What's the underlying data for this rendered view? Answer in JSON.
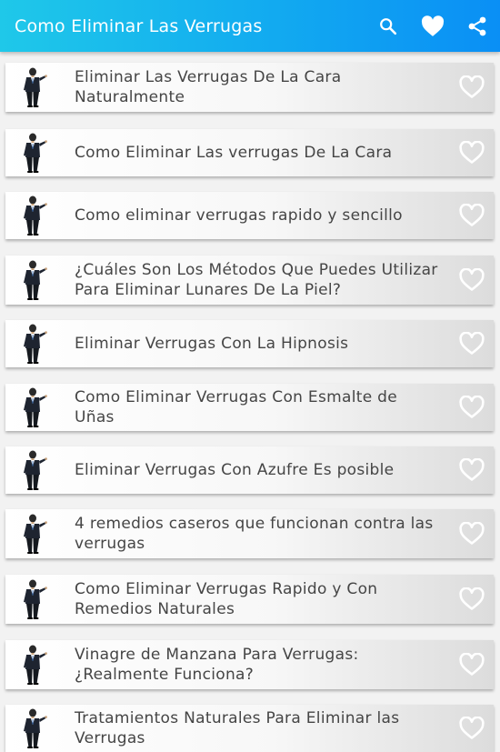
{
  "appbar": {
    "title": "Como Eliminar Las Verrugas",
    "icons": [
      "search-icon",
      "heart-icon",
      "share-icon"
    ],
    "color": "#12aaf0"
  },
  "articles": [
    {
      "title": "Eliminar Las Verrugas De La Cara Naturalmente"
    },
    {
      "title": "Como Eliminar Las verrugas De La Cara"
    },
    {
      "title": "Como eliminar verrugas rapido y sencillo"
    },
    {
      "title": "¿Cuáles Son Los Métodos Que Puedes Utilizar Para Eliminar Lunares De La Piel?"
    },
    {
      "title": "Eliminar Verrugas Con La Hipnosis"
    },
    {
      "title": "Como Eliminar Verrugas Con Esmalte de Uñas"
    },
    {
      "title": "Eliminar Verrugas Con Azufre Es posible"
    },
    {
      "title": "4 remedios caseros que funcionan contra las verrugas"
    },
    {
      "title": "Como Eliminar Verrugas Rapido y Con Remedios Naturales"
    },
    {
      "title": "Vinagre de Manzana Para Verrugas: ¿Realmente Funciona?"
    },
    {
      "title": "Tratamientos Naturales Para Eliminar las Verrugas"
    }
  ]
}
